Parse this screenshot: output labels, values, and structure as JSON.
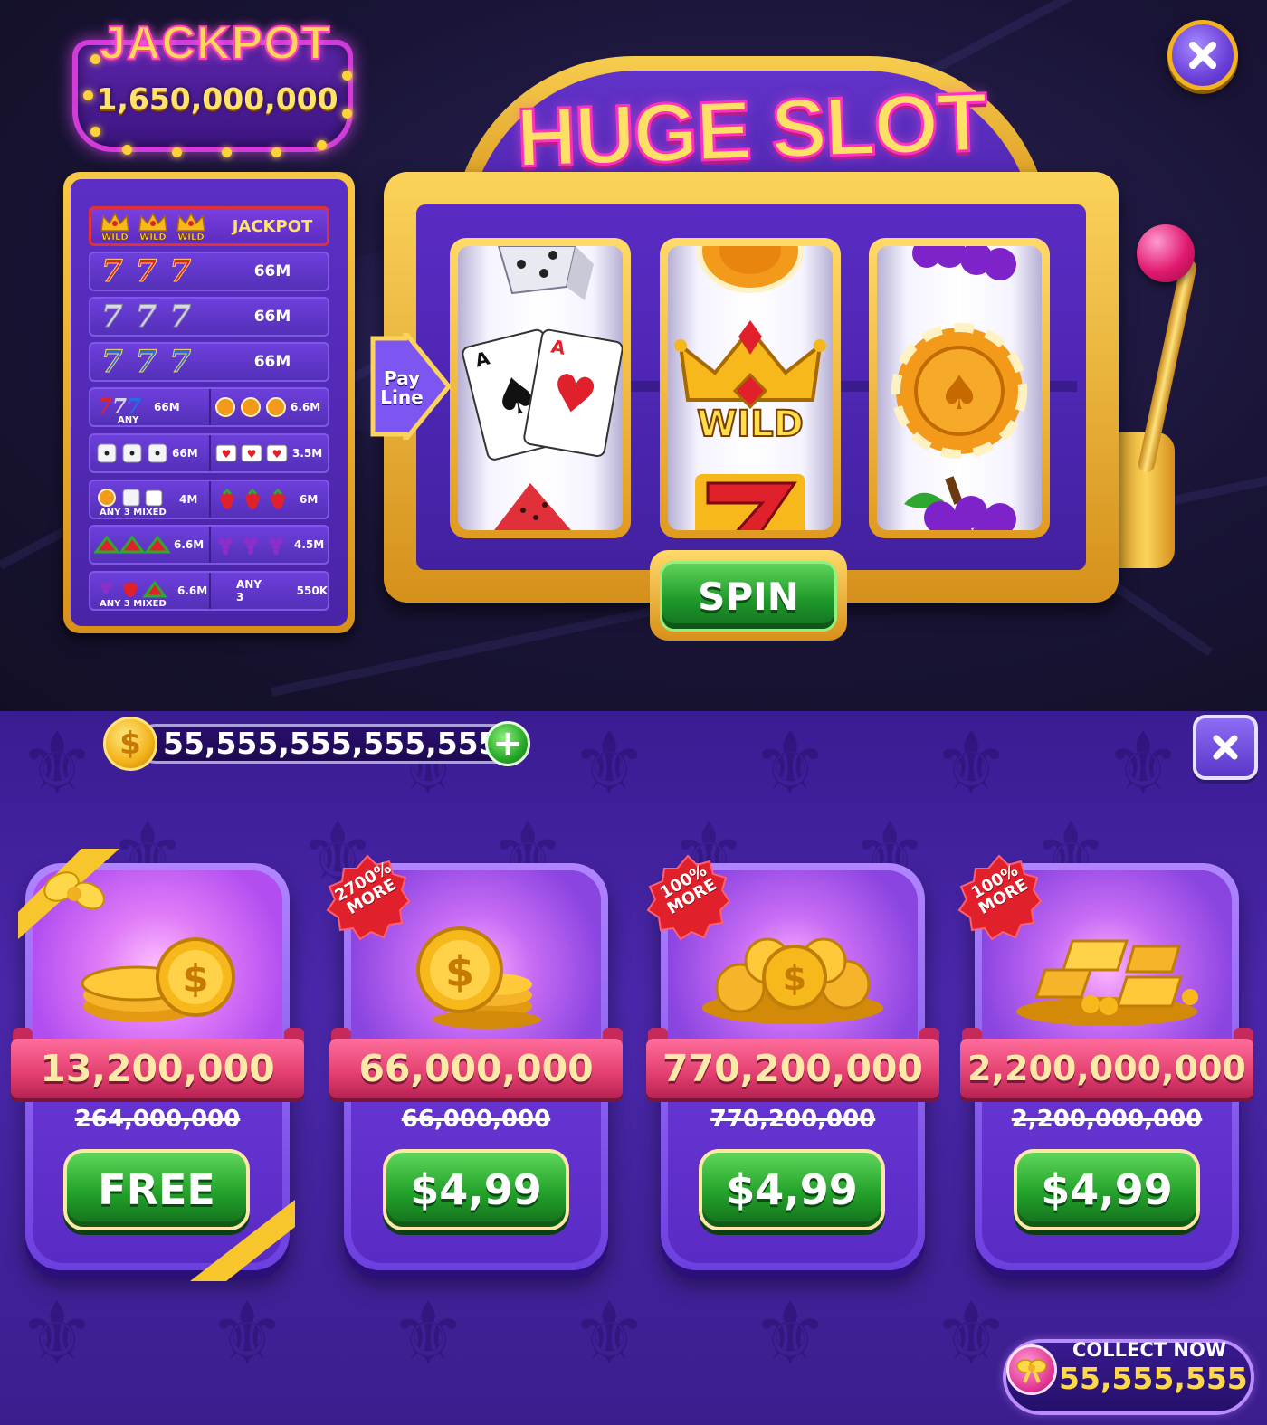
{
  "jackpot": {
    "title": "JACKPOT",
    "amount": "1,650,000,000"
  },
  "machine": {
    "title": "HUGE SLOT",
    "payline_label_1": "Pay",
    "payline_label_2": "Line",
    "spin_label": "SPIN",
    "reels": [
      {
        "top": "dice",
        "center": "playing-cards",
        "bottom": "watermelon"
      },
      {
        "top": "poker-chip",
        "center": "wild-crown",
        "bottom": "red-seven"
      },
      {
        "top": "grapes",
        "center": "poker-chip",
        "bottom": "grapes"
      }
    ],
    "wild_label": "WILD"
  },
  "paytable": {
    "jackpot_row": {
      "symbols": [
        "WILD",
        "WILD",
        "WILD"
      ],
      "payout": "JACKPOT"
    },
    "seven_rows": [
      {
        "color": "#e0202a",
        "payout": "66M"
      },
      {
        "color": "#c9c9d6",
        "payout": "66M"
      },
      {
        "color": "#1f6fe8",
        "payout": "66M"
      }
    ],
    "split_rows": [
      {
        "left_payout": "66M",
        "left_note": "ANY",
        "left_icon": "any-seven",
        "right_payout": "6.6M",
        "right_icon": "poker-chip"
      },
      {
        "left_payout": "66M",
        "left_note": "",
        "left_icon": "dice",
        "right_payout": "3.5M",
        "right_icon": "playing-cards"
      },
      {
        "left_payout": "4M",
        "left_note": "ANY 3 MIXED",
        "left_icon": "mixed",
        "right_payout": "6M",
        "right_icon": "strawberry"
      },
      {
        "left_payout": "6.6M",
        "left_note": "",
        "left_icon": "watermelon",
        "right_payout": "4.5M",
        "right_icon": "grapes"
      },
      {
        "left_payout": "6.6M",
        "left_note": "ANY 3 MIXED",
        "left_icon": "mixed-fruit",
        "right_payout": "550K",
        "right_label": "ANY 3"
      }
    ]
  },
  "shop": {
    "balance": "55,555,555,555,555",
    "offers": [
      {
        "amount": "13,200,000",
        "old_amount": "264,000,000",
        "price": "FREE",
        "badge": "",
        "art": "gold-coins-stack"
      },
      {
        "amount": "66,000,000",
        "old_amount": "66,000,000",
        "price": "$4,99",
        "badge_line1": "2700%",
        "badge_line2": "MORE",
        "art": "gold-coin-pile-small"
      },
      {
        "amount": "770,200,000",
        "old_amount": "770,200,000",
        "price": "$4,99",
        "badge_line1": "100%",
        "badge_line2": "MORE",
        "art": "gold-coin-pile-large"
      },
      {
        "amount": "2,200,000,000",
        "old_amount": "2,200,000,000",
        "price": "$4,99",
        "badge_line1": "100%",
        "badge_line2": "MORE",
        "art": "gold-bars"
      }
    ],
    "collect": {
      "label": "COLLECT NOW",
      "value": "55,555,555"
    }
  },
  "colors": {
    "gold": "#f3b21f",
    "purple": "#5a2bc4",
    "pink": "#e23f6e",
    "green": "#22a12a"
  }
}
